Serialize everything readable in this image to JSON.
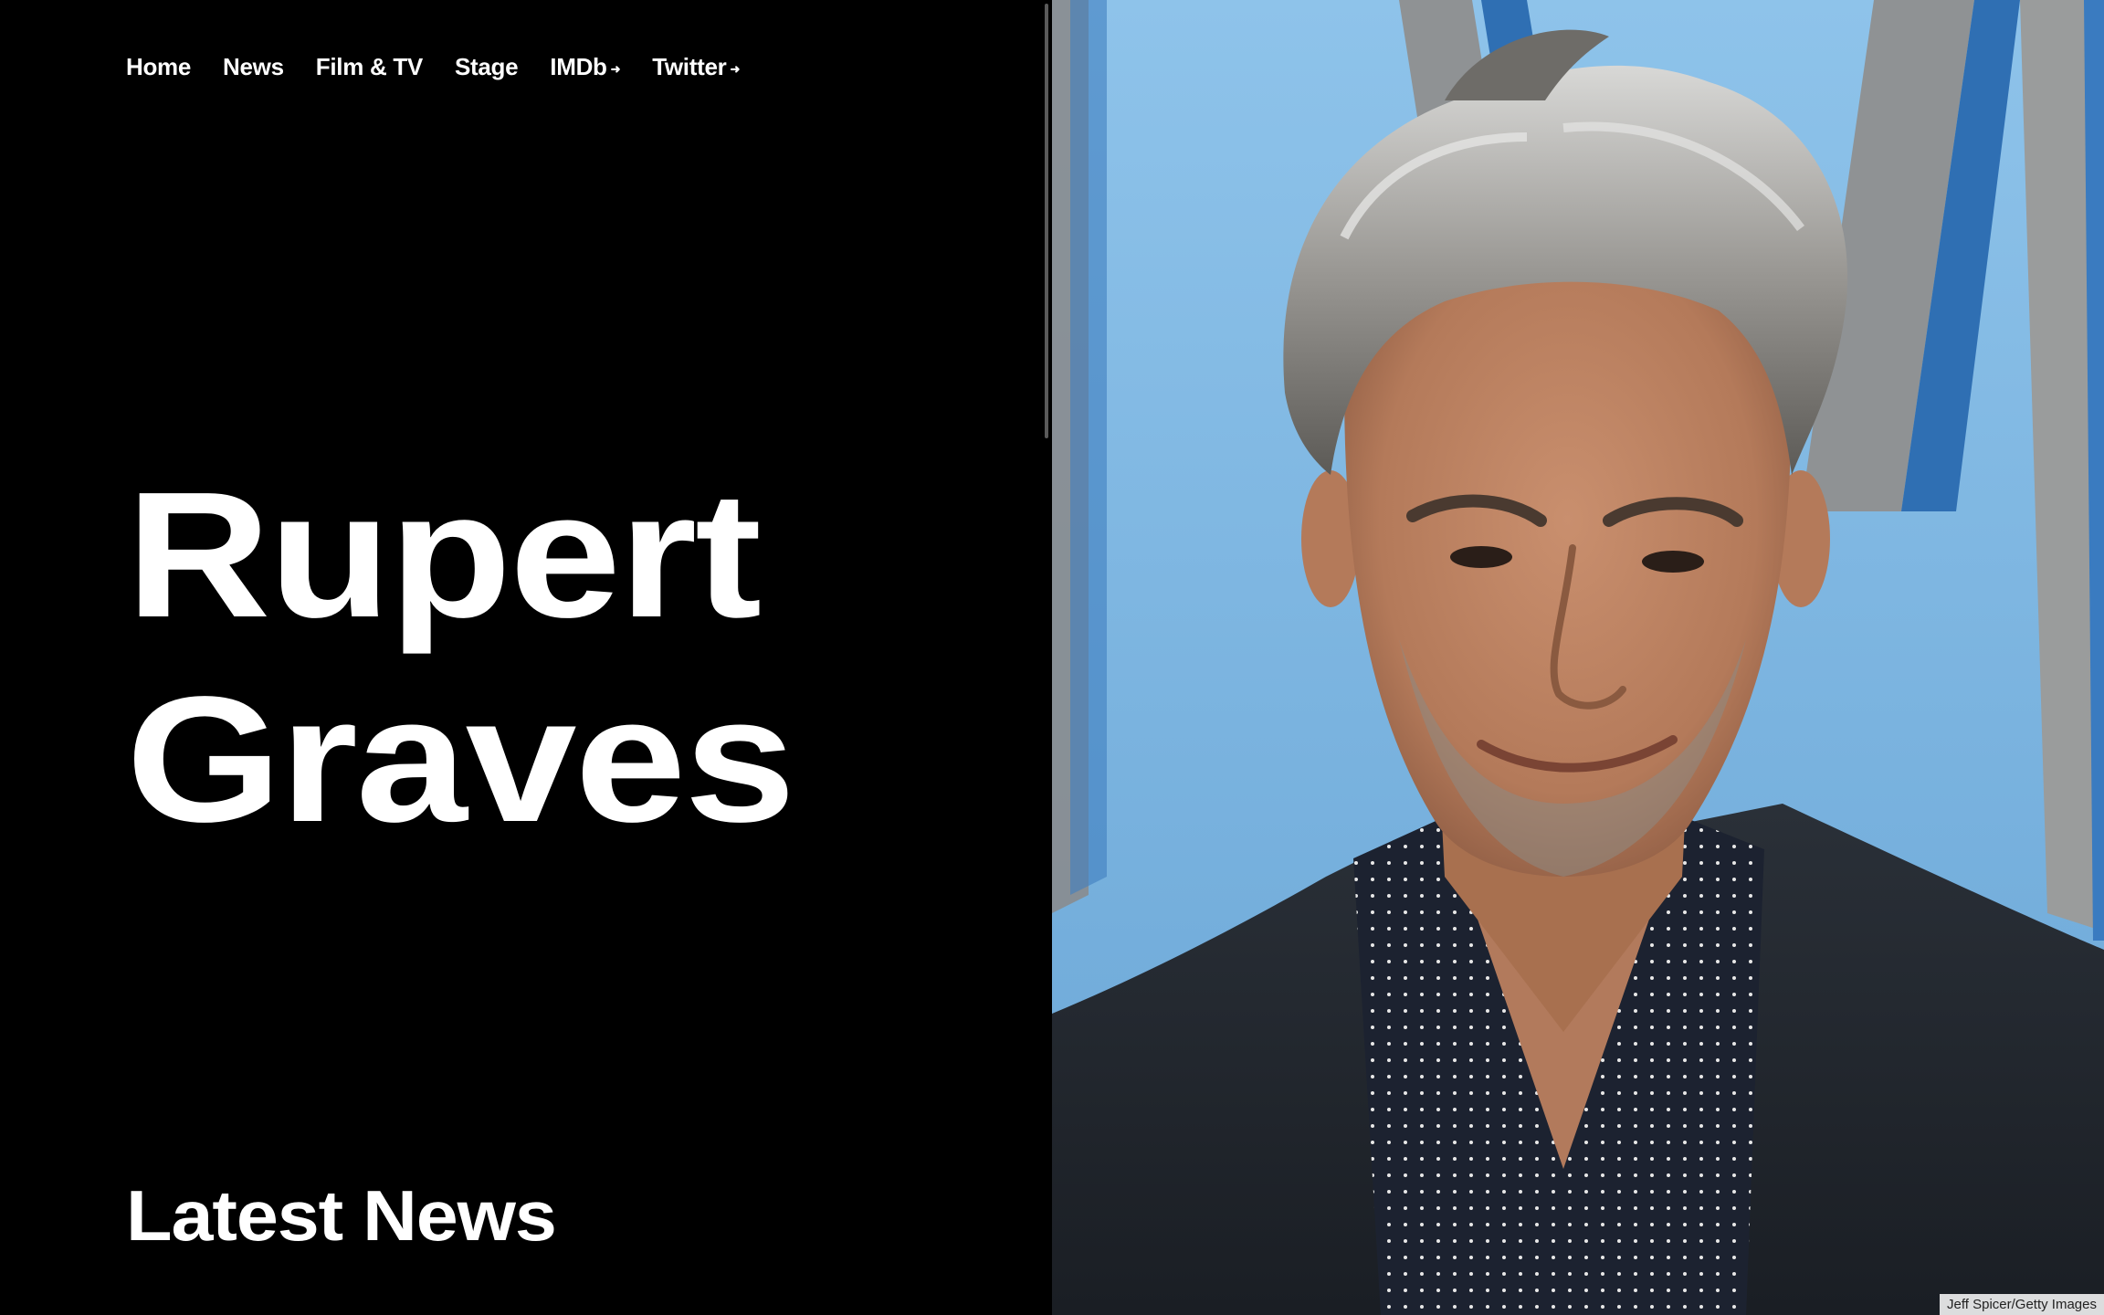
{
  "nav": {
    "items": [
      {
        "label": "Home",
        "external": false
      },
      {
        "label": "News",
        "external": false
      },
      {
        "label": "Film & TV",
        "external": false
      },
      {
        "label": "Stage",
        "external": false
      },
      {
        "label": "IMDb",
        "external": true
      },
      {
        "label": "Twitter",
        "external": true
      }
    ],
    "external_icon": "external-link-icon"
  },
  "hero": {
    "first_name": "Rupert",
    "last_name": "Graves"
  },
  "section": {
    "title": "Latest News"
  },
  "photo": {
    "credit": "Jeff Spicer/Getty Images"
  },
  "colors": {
    "background": "#000000",
    "text": "#ffffff",
    "photo_backdrop": "#7fb7e3"
  }
}
